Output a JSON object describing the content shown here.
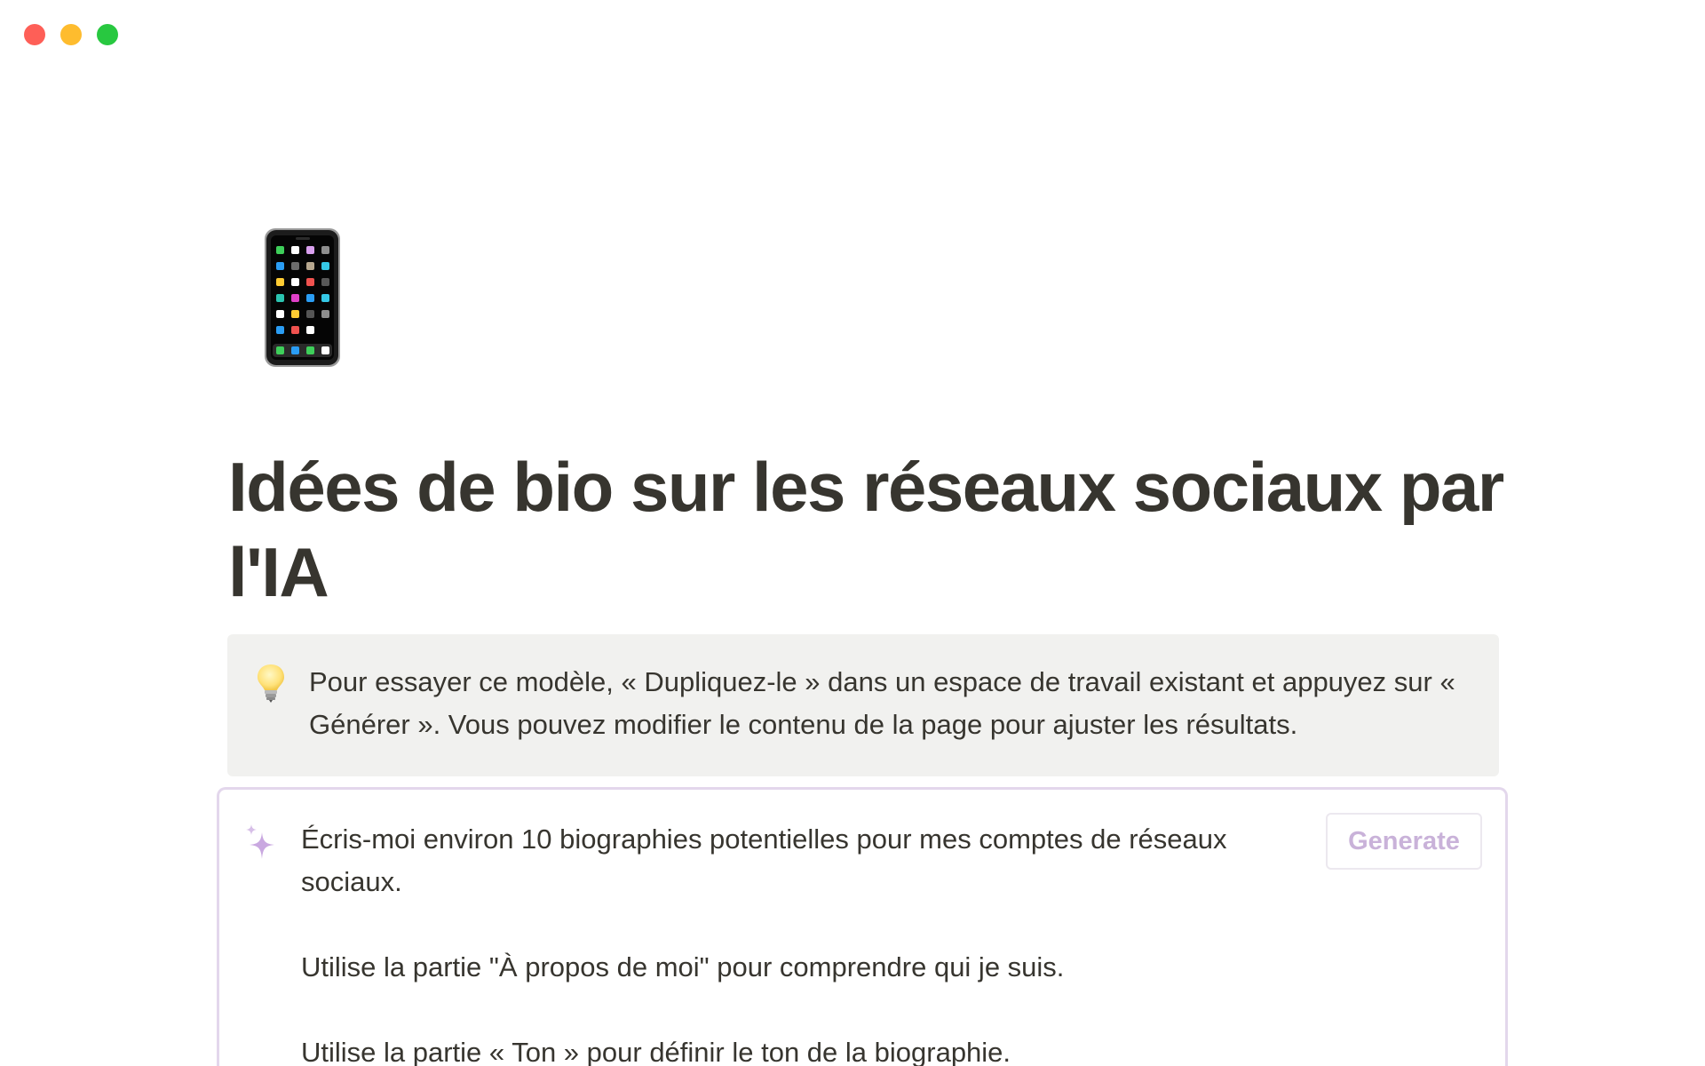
{
  "window": {
    "traffic_lights": [
      {
        "name": "close",
        "color": "#fe5f57"
      },
      {
        "name": "minimize",
        "color": "#febc2e"
      },
      {
        "name": "zoom",
        "color": "#28c840"
      }
    ]
  },
  "page": {
    "icon": "mobile-phone-icon",
    "title": "Idées de bio sur les réseaux sociaux par l'IA"
  },
  "callout": {
    "icon": "light-bulb-icon",
    "text": "Pour essayer ce modèle, « Dupliquez-le » dans un espace de travail existant et appuyez sur « Générer ». Vous pouvez modifier le contenu de la page pour ajuster les résultats."
  },
  "ai_block": {
    "icon": "sparkle-icon",
    "generate_label": "Generate",
    "accent_color": "#c9b2d9",
    "prompt_lines": [
      "Écris-moi environ 10 biographies potentielles pour mes comptes de réseaux sociaux.",
      "Utilise la partie \"À propos de moi\" pour comprendre qui je suis.",
      "Utilise la partie « Ton » pour définir le ton de la biographie."
    ]
  }
}
